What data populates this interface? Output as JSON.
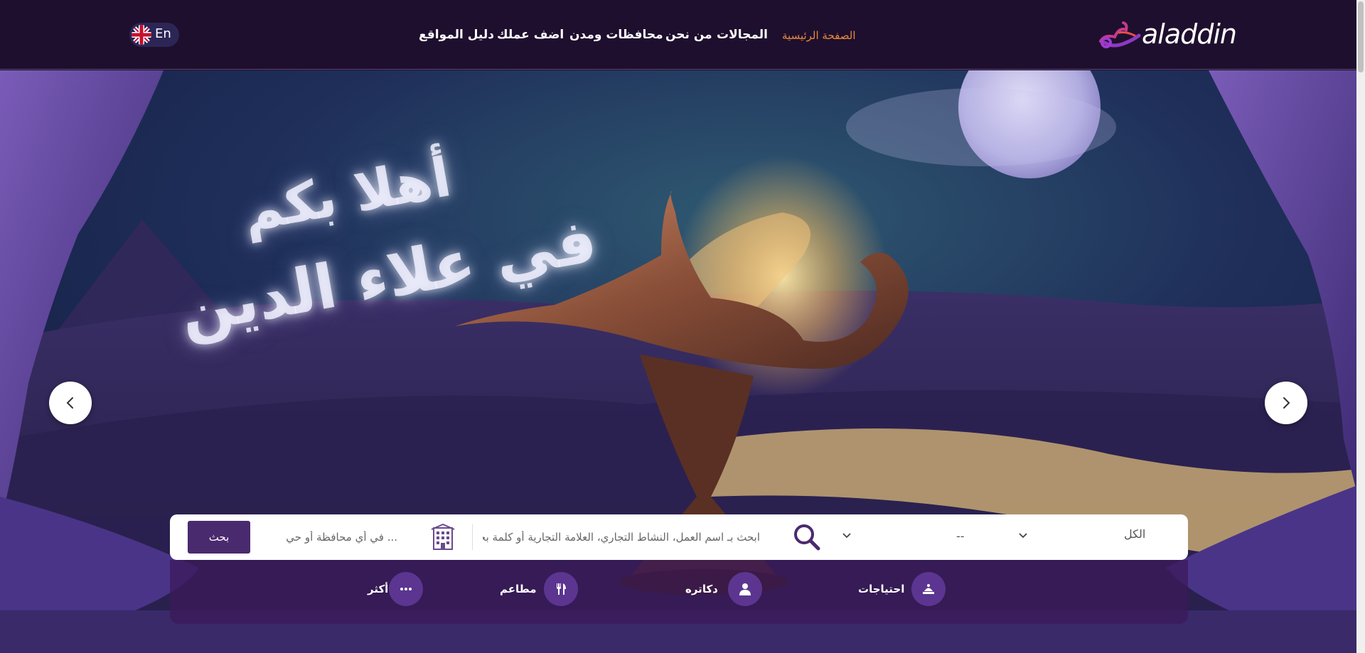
{
  "brand": {
    "logo_text": "aladdin",
    "accent": "#e8893c",
    "primary": "#4a2a6e",
    "header_bg": "#1e0f2e"
  },
  "header": {
    "nav": [
      {
        "id": "home",
        "label": "الصفحة الرئيسية",
        "active": true
      },
      {
        "id": "categories",
        "label": "المجالات"
      },
      {
        "id": "about",
        "label": "من نحن"
      },
      {
        "id": "cities",
        "label": "محافظات ومدن"
      },
      {
        "id": "add_business",
        "label": "اضف عملك"
      },
      {
        "id": "sites",
        "label": "دليل المواقع"
      }
    ],
    "language_label": "En",
    "language_icon": "uk-flag-icon"
  },
  "hero": {
    "welcome_line1": "أهلا بكم",
    "welcome_line2": "في علاء الدين",
    "prev_icon": "chevron-left-icon",
    "next_icon": "chevron-right-icon"
  },
  "search": {
    "scope_value": "الكل",
    "subcategory_value": "--",
    "keyword_placeholder": "ابحث بـ اسم العمل، النشاط التجاري، العلامة التجارية أو كلمة بحث ...",
    "location_placeholder": "... في أي محافظة أو حي",
    "button_label": "بحث"
  },
  "categories": [
    {
      "label": "احتياجات",
      "icon": "hand-care-icon"
    },
    {
      "label": "دكاتره",
      "icon": "doctor-icon"
    },
    {
      "label": "مطاعم",
      "icon": "fork-knife-icon"
    },
    {
      "label": "أكثر",
      "icon": "more-dots-icon"
    }
  ]
}
